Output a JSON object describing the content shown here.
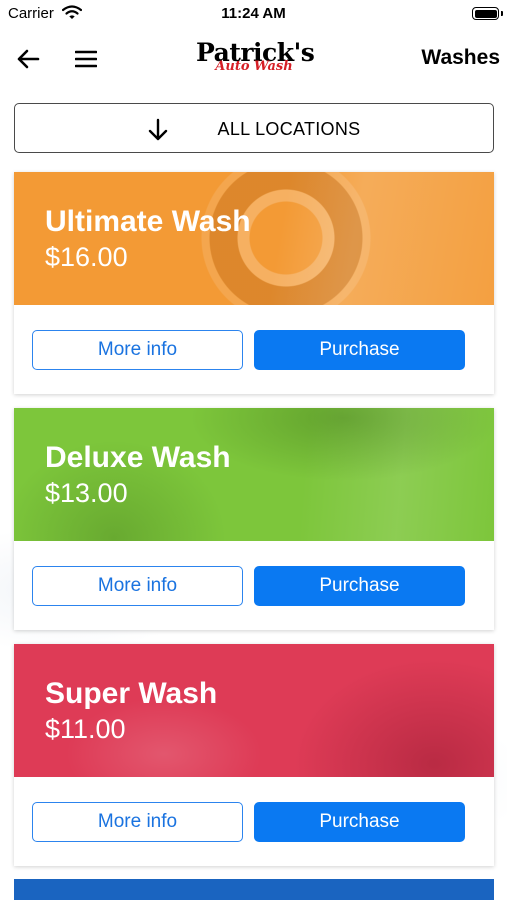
{
  "status_bar": {
    "carrier": "Carrier",
    "time": "11:24 AM"
  },
  "nav": {
    "title": "Washes",
    "logo": {
      "line1": "Patrick's",
      "line2": "Auto Wash"
    },
    "icons": {
      "back": "arrow-left-icon",
      "menu": "hamburger-menu-icon"
    }
  },
  "location_filter": {
    "label": "ALL LOCATIONS",
    "icon": "arrow-down-icon"
  },
  "washes": [
    {
      "name": "Ultimate Wash",
      "price": "$16.00",
      "color": "#f39a35",
      "more_info": "More info",
      "purchase": "Purchase"
    },
    {
      "name": "Deluxe Wash",
      "price": "$13.00",
      "color": "#7dc63b",
      "more_info": "More info",
      "purchase": "Purchase"
    },
    {
      "name": "Super Wash",
      "price": "$11.00",
      "color": "#de3b56",
      "more_info": "More info",
      "purchase": "Purchase"
    }
  ],
  "colors": {
    "primary_button": "#0a79f2",
    "outline_button": "#2c84ee",
    "logo_accent": "#d61f26",
    "next_card": "#1a64c0"
  }
}
